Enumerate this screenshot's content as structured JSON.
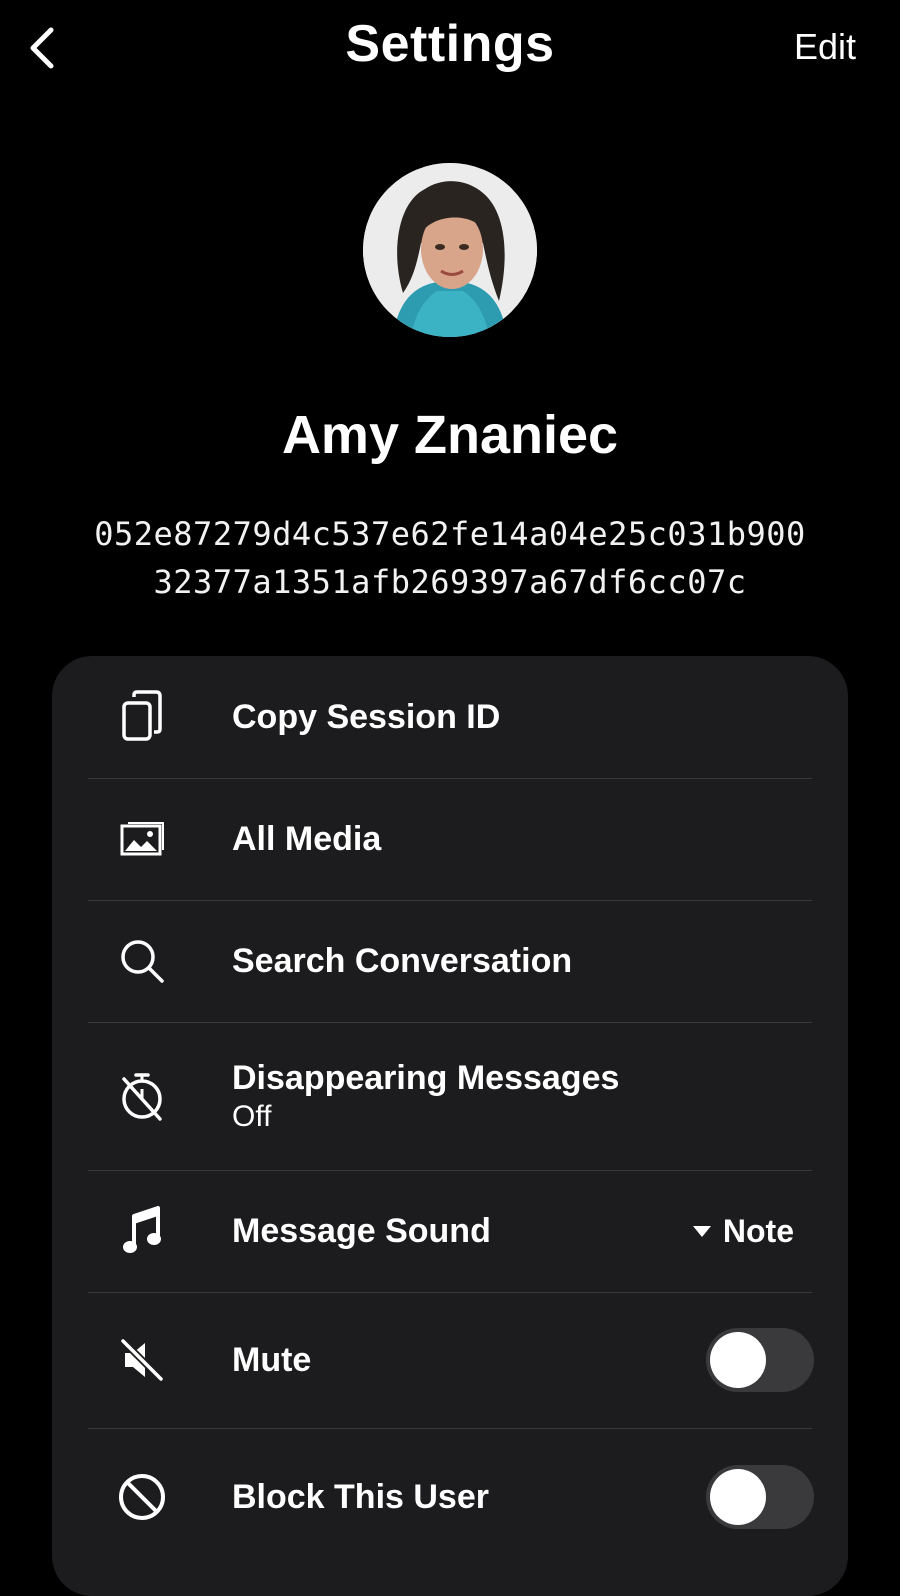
{
  "header": {
    "title": "Settings",
    "edit_label": "Edit"
  },
  "profile": {
    "name": "Amy Znaniec",
    "session_id_line1": "052e87279d4c537e62fe14a04e25c031b900",
    "session_id_line2": "32377a1351afb269397a67df6cc07c"
  },
  "menu": {
    "copy_session": {
      "label": "Copy Session ID",
      "icon": "copy-icon"
    },
    "all_media": {
      "label": "All Media",
      "icon": "image-icon"
    },
    "search": {
      "label": "Search Conversation",
      "icon": "search-icon"
    },
    "disappearing": {
      "label": "Disappearing Messages",
      "value": "Off",
      "icon": "timer-off-icon"
    },
    "sound": {
      "label": "Message Sound",
      "value": "Note",
      "icon": "music-note-icon"
    },
    "mute": {
      "label": "Mute",
      "enabled": false,
      "icon": "speaker-muted-icon"
    },
    "block": {
      "label": "Block This User",
      "enabled": false,
      "icon": "block-icon"
    }
  }
}
